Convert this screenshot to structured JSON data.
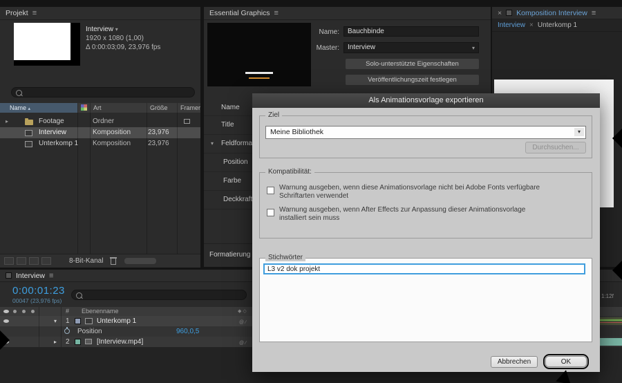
{
  "colors": {
    "accent_blue": "#3e9fe0",
    "focus_blue": "#3f9ddd",
    "panel_bg": "#2b2b2b",
    "dialog_bg": "#c9c9c9",
    "timeline_bar_olive": "#4a5038",
    "timeline_bar_teal": "#79b5a4"
  },
  "icons": {
    "hamburger": "≡",
    "chevron_right": "▸",
    "chevron_down": "▾",
    "sort_up": "▴",
    "close": "×"
  },
  "project": {
    "title": "Projekt",
    "comp_name": "Interview",
    "size": "1920 x 1080 (1,00)",
    "duration": "Δ 0:00:03;09, 23,976 fps",
    "columns": {
      "name": "Name",
      "art": "Art",
      "size": "Größe",
      "fps": "Framera..."
    },
    "rows": [
      {
        "name": "Footage",
        "type": "Ordner",
        "fps": ""
      },
      {
        "name": "Interview",
        "type": "Komposition",
        "fps": "23,976"
      },
      {
        "name": "Unterkomp 1",
        "type": "Komposition",
        "fps": "23,976"
      }
    ],
    "bit_depth": "8-Bit-Kanal"
  },
  "eg": {
    "title": "Essential Graphics",
    "name_label": "Name:",
    "name_value": "Bauchbinde",
    "master_label": "Master:",
    "master_value": "Interview",
    "solo_button": "Solo-unterstützte Eigenschaften",
    "publish_button": "Veröffentlichungszeit festlegen",
    "list_header": "Name",
    "items": [
      "Title",
      "Feldformatierun",
      "Position",
      "Farbe",
      "Deckkraft"
    ],
    "footer_button": "Formatierung hinzuf"
  },
  "comp": {
    "title": "Komposition Interview",
    "tab_active": "Interview",
    "tab_inactive": "Unterkomp 1"
  },
  "dialog": {
    "title": "Als Animationsvorlage exportieren",
    "ziel_label": "Ziel",
    "destination": "Meine Bibliothek",
    "browse": "Durchsuchen...",
    "compat_label": "Kompatibilität:",
    "cb1_line1": "Warnung ausgeben, wenn diese Animationsvorlage nicht bei Adobe Fonts verfügbare",
    "cb1_line2": "Schriftarten verwendet",
    "cb2_line1": "Warnung ausgeben, wenn After Effects zur Anpassung dieser Animationsvorlage",
    "cb2_line2": "installiert sein muss",
    "keywords_label": "Stichwörter",
    "keywords_value": "L3 v2 dok projekt",
    "cancel": "Abbrechen",
    "ok": "OK"
  },
  "timeline": {
    "tab": "Interview",
    "timecode": "0:00:01:23",
    "frame_info": "00047 (23,976 fps)",
    "num_col": "#",
    "layer_col": "Ebenenname",
    "row1_num": "1",
    "row1_name": "Unterkomp 1",
    "prop_name": "Position",
    "prop_value": "960,0,5",
    "row2_num": "2",
    "row2_name": "[Interview.mp4]",
    "ruler_label": "1:12f"
  }
}
